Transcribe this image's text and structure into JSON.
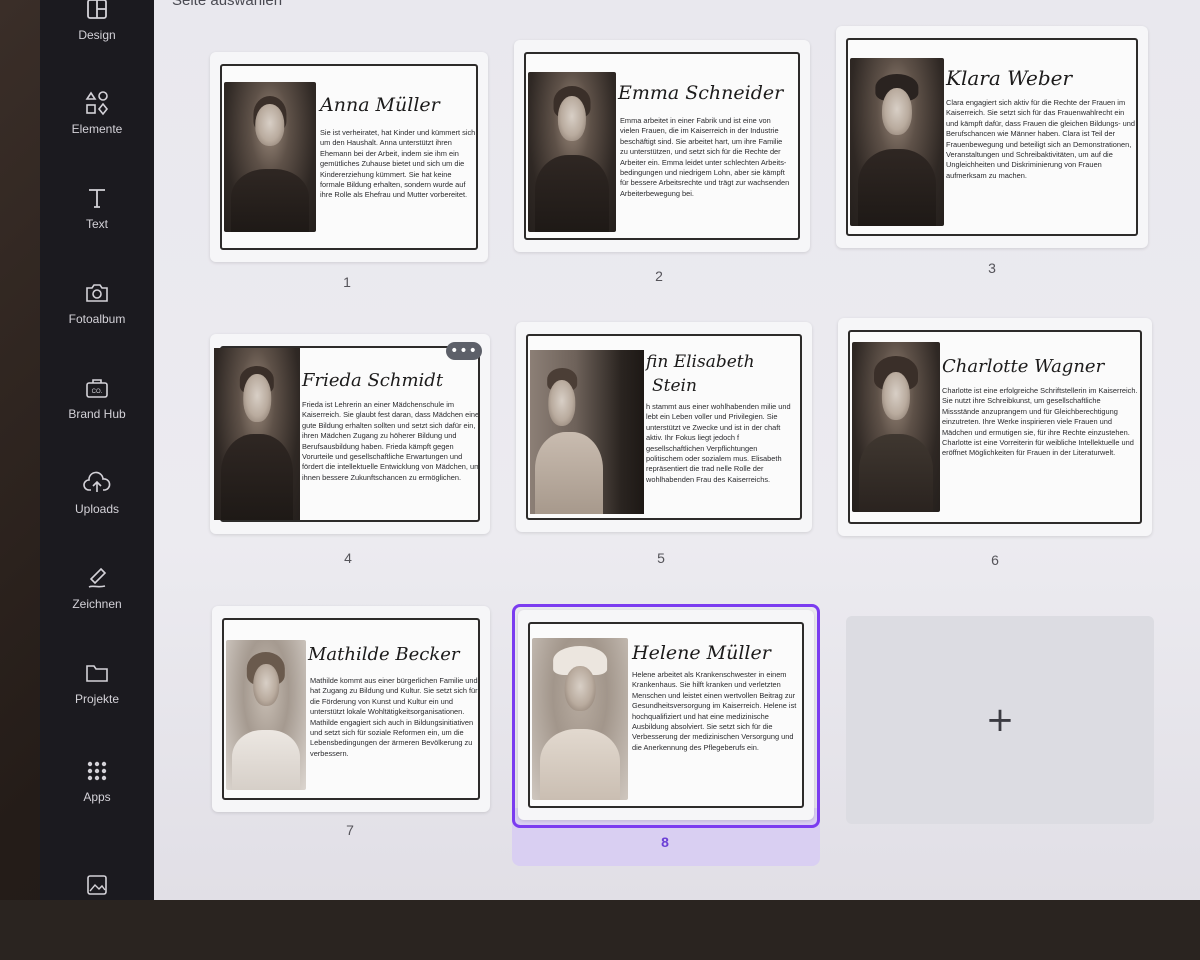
{
  "header": {
    "partial_label": "Seite auswählen"
  },
  "sidebar": {
    "items": [
      {
        "label": "Design",
        "icon": "layout-icon"
      },
      {
        "label": "Elemente",
        "icon": "shapes-icon"
      },
      {
        "label": "Text",
        "icon": "text-icon"
      },
      {
        "label": "Fotoalbum",
        "icon": "camera-icon"
      },
      {
        "label": "Brand Hub",
        "icon": "brand-icon"
      },
      {
        "label": "Uploads",
        "icon": "cloud-upload-icon"
      },
      {
        "label": "Zeichnen",
        "icon": "draw-icon"
      },
      {
        "label": "Projekte",
        "icon": "folder-icon"
      },
      {
        "label": "Apps",
        "icon": "apps-grid-icon"
      },
      {
        "label": "",
        "icon": "image-icon"
      }
    ]
  },
  "pages": [
    {
      "num": "1",
      "name": "Anna Müller",
      "desc": "Sie ist verheiratet, hat Kinder und kümmert sich um den Haushalt. Anna unterstützt ihren Ehemann bei der Arbeit, indem sie ihm ein gemütliches Zuhause bietet und sich um die Kindererziehung kümmert. Sie hat keine formale Bildung erhalten, sondern wurde auf ihre Rolle als Ehefrau und Mutter vorbereitet."
    },
    {
      "num": "2",
      "name": "Emma Schneider",
      "desc": "Emma arbeitet in einer Fabrik und ist eine von vielen Frauen, die im Kaiserreich in der Industrie beschäftigt sind. Sie arbeitet hart, um ihre Familie zu unterstützen, und setzt sich für die Rechte der Arbeiter ein. Emma leidet unter schlechten Arbeits-bedingungen und niedrigem Lohn, aber sie kämpft für bessere Arbeitsrechte und trägt zur wachsenden Arbeiterbewegung bei."
    },
    {
      "num": "3",
      "name": "Klara Weber",
      "desc": "Clara engagiert sich aktiv für die Rechte der Frauen im Kaiserreich. Sie setzt sich für das Frauenwahlrecht ein und kämpft dafür, dass Frauen die gleichen Bildungs- und Berufschancen wie Männer haben. Clara ist Teil der Frauenbewegung und beteiligt sich an Demonstrationen, Veranstaltungen und Schreibaktivitäten, um auf die Ungleichheiten und Diskriminierung von Frauen aufmerksam zu machen."
    },
    {
      "num": "4",
      "name": "Frieda Schmidt",
      "desc": "Frieda ist Lehrerin an einer Mädchenschule im Kaiserreich. Sie glaubt fest daran, dass Mädchen eine gute Bildung erhalten sollten und setzt sich dafür ein, ihren Mädchen Zugang zu höherer Bildung und Berufsausbildung haben. Frieda kämpft gegen Vorurteile und gesellschaftliche Erwartungen und fördert die intellektuelle Entwicklung von Mädchen, um ihnen bessere Zukunftschancen zu ermöglichen."
    },
    {
      "num": "5",
      "name": "fin Elisabeth",
      "name2": "Stein",
      "desc": "h stammt aus einer wohlhabenden milie und lebt ein Leben voller und Privilegien. Sie unterstützt ve Zwecke und ist in der chaft aktiv. Ihr Fokus liegt jedoch f gesellschaftlichen Verpflichtungen politischem oder sozialem mus. Elisabeth repräsentiert die trad nelle Rolle der wohlhabenden Frau des Kaiserreichs."
    },
    {
      "num": "6",
      "name": "Charlotte Wagner",
      "desc": "Charlotte ist eine erfolgreiche Schriftstellerin im Kaiserreich. Sie nutzt ihre Schreibkunst, um gesellschaftliche Missstände anzuprangern und für Gleichberechtigung einzutreten. Ihre Werke inspirieren viele Frauen und Mädchen und ermutigen sie, für ihre Rechte einzustehen. Charlotte ist eine Vorreiterin für weibliche Intellektuelle und eröffnet Möglichkeiten für Frauen in der Literaturwelt."
    },
    {
      "num": "7",
      "name": "Mathilde Becker",
      "desc": "Mathilde kommt aus einer bürgerlichen Familie und hat Zugang zu Bildung und Kultur. Sie setzt sich für die Förderung von Kunst und Kultur ein und unterstützt lokale Wohltätigkeitsorganisationen. Mathilde engagiert sich auch in Bildungsinitiativen und setzt sich für soziale Reformen ein, um die Lebensbedingungen der ärmeren Bevölkerung zu verbessern."
    },
    {
      "num": "8",
      "name": "Helene Müller",
      "desc": "Helene arbeitet als Krankenschwester in einem Krankenhaus. Sie hilft kranken und verletzten Menschen und leistet einen wertvollen Beitrag zur Gesundheitsversorgung im Kaiserreich. Helene ist hochqualifiziert und hat eine medizinische Ausbildung absolviert. Sie setzt sich für die Verbesserung der medizinischen Versorgung und die Anerkennung des Pflegeberufs ein."
    }
  ],
  "more_button": "•••",
  "add_page": "+",
  "colors": {
    "selection": "#7b3cf0",
    "sidebar": "#1b1a1f"
  }
}
